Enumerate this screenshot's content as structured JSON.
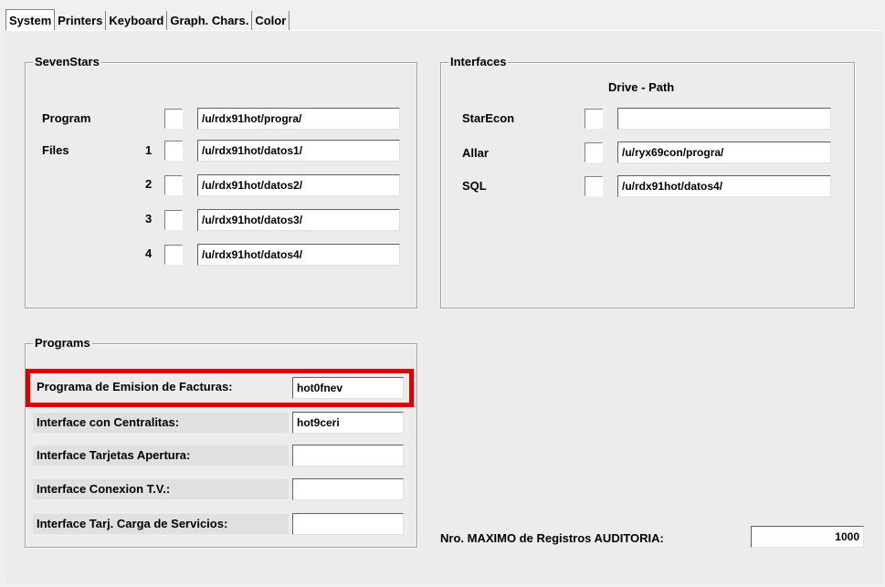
{
  "tabs": [
    "System",
    "Printers",
    "Keyboard",
    "Graph. Chars.",
    "Color"
  ],
  "sevenstars": {
    "title": "SevenStars",
    "program_label": "Program",
    "files_label": "Files",
    "program_path": "/u/rdx91hot/progra/",
    "files": [
      {
        "num": "1",
        "path": "/u/rdx91hot/datos1/"
      },
      {
        "num": "2",
        "path": "/u/rdx91hot/datos2/"
      },
      {
        "num": "3",
        "path": "/u/rdx91hot/datos3/"
      },
      {
        "num": "4",
        "path": "/u/rdx91hot/datos4/"
      }
    ]
  },
  "interfaces": {
    "title": "Interfaces",
    "column_header": "Drive - Path",
    "rows": [
      {
        "label": "StarEcon",
        "path": ""
      },
      {
        "label": "Allar",
        "path": "/u/ryx69con/progra/"
      },
      {
        "label": "SQL",
        "path": "/u/rdx91hot/datos4/"
      }
    ]
  },
  "programs": {
    "title": "Programs",
    "rows": [
      {
        "label": "Programa de Emision de Facturas:",
        "value": "hot0fnev"
      },
      {
        "label": "Interface con Centralitas:",
        "value": "hot9ceri"
      },
      {
        "label": "Interface Tarjetas Apertura:",
        "value": ""
      },
      {
        "label": "Interface Conexion T.V.:",
        "value": ""
      },
      {
        "label": "Interface Tarj. Carga de Servicios:",
        "value": ""
      }
    ]
  },
  "auditoria": {
    "label": "Nro. MAXIMO de Registros AUDITORIA:",
    "value": "1000"
  },
  "colors": {
    "highlight": "#e00000"
  }
}
